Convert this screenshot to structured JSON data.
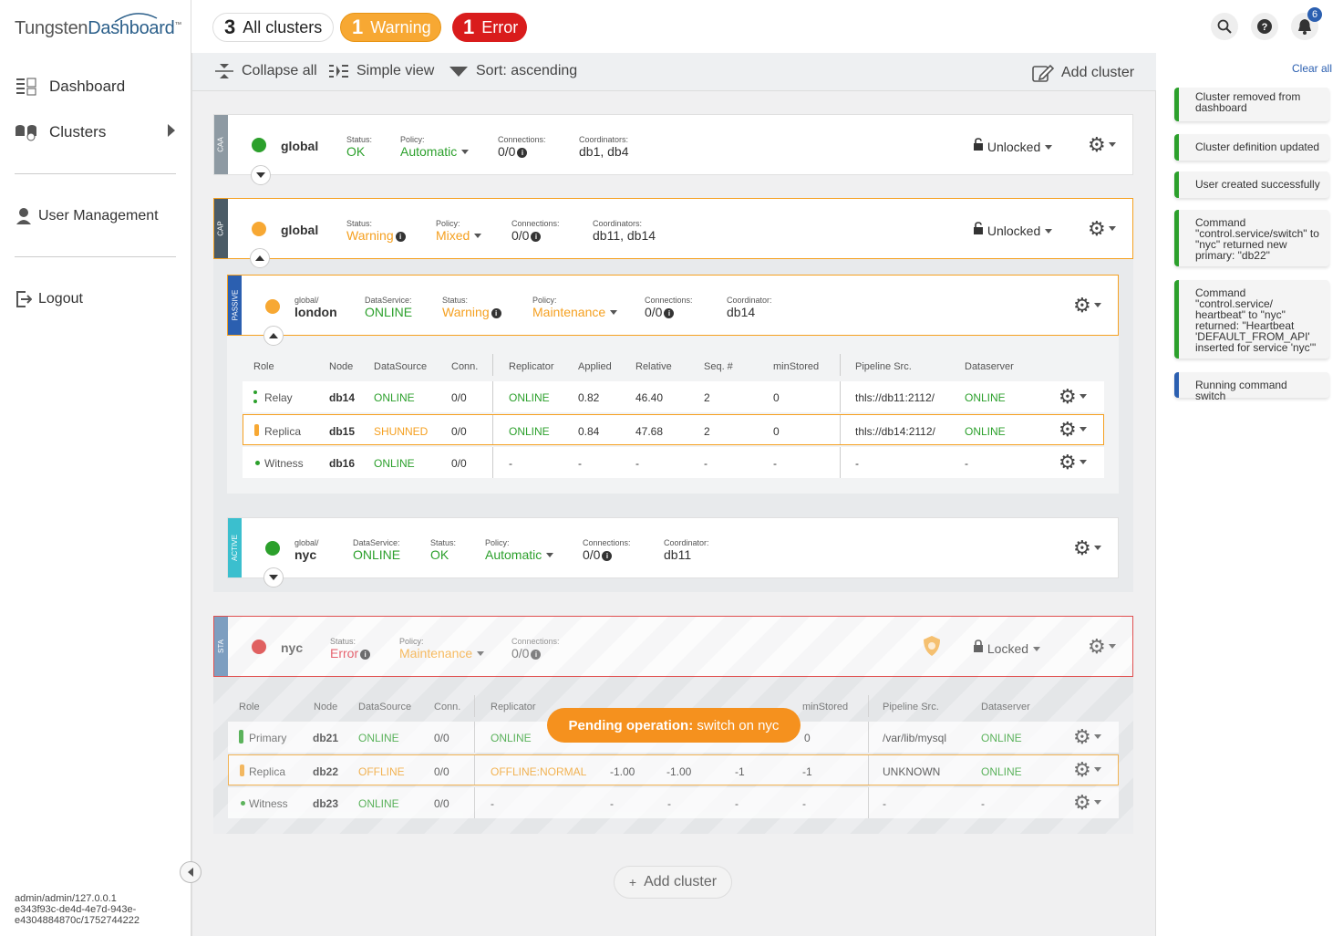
{
  "brand": {
    "part1": "Tungsten",
    "part2": "Dashboard",
    "tm": "™"
  },
  "nav": {
    "dashboard": "Dashboard",
    "clusters": "Clusters",
    "user_management": "User Management",
    "logout": "Logout"
  },
  "footer_info": {
    "line1": "admin/admin/127.0.0.1",
    "line2": "e343f93c-de4d-4e7d-943e-",
    "line3": "e4304884870c/1752744222"
  },
  "summary": {
    "all_count": "3",
    "all_label": "All clusters",
    "warning_count": "1",
    "warning_label": "Warning",
    "error_count": "1",
    "error_label": "Error"
  },
  "notifications_count": "6",
  "toolbar": {
    "collapse_all": "Collapse all",
    "simple_view": "Simple view",
    "sort": "Sort: ascending",
    "add_cluster": "Add cluster"
  },
  "labels": {
    "status": "Status:",
    "policy": "Policy:",
    "connections": "Connections:",
    "coordinators": "Coordinators:",
    "coordinator": "Coordinator:",
    "dataservice": "DataService:"
  },
  "caa": {
    "tag": "CAA",
    "name": "global",
    "status": "OK",
    "policy": "Automatic",
    "connections": "0/0",
    "coordinators": "db1, db4",
    "lock": "Unlocked"
  },
  "cap": {
    "tag": "CAP",
    "name": "global",
    "status": "Warning",
    "policy": "Mixed",
    "connections": "0/0",
    "coordinators": "db11, db14",
    "lock": "Unlocked"
  },
  "london": {
    "tag": "PASSIVE",
    "prefix": "global/",
    "name": "london",
    "dataservice": "ONLINE",
    "status": "Warning",
    "policy": "Maintenance",
    "connections": "0/0",
    "coordinator": "db14"
  },
  "table_headers": {
    "role": "Role",
    "node": "Node",
    "datasource": "DataSource",
    "conn": "Conn.",
    "replicator": "Replicator",
    "applied": "Applied",
    "relative": "Relative",
    "seq": "Seq. #",
    "minstored": "minStored",
    "pipeline": "Pipeline Src.",
    "dataserver": "Dataserver"
  },
  "london_rows": [
    {
      "role": "Relay",
      "node": "db14",
      "datasource": "ONLINE",
      "conn": "0/0",
      "replicator": "ONLINE",
      "applied": "0.82",
      "relative": "46.40",
      "seq": "2",
      "minstored": "0",
      "pipeline": "thls://db11:2112/",
      "dataserver": "ONLINE"
    },
    {
      "role": "Replica",
      "node": "db15",
      "datasource": "SHUNNED",
      "conn": "0/0",
      "replicator": "ONLINE",
      "applied": "0.84",
      "relative": "47.68",
      "seq": "2",
      "minstored": "0",
      "pipeline": "thls://db14:2112/",
      "dataserver": "ONLINE"
    },
    {
      "role": "Witness",
      "node": "db16",
      "datasource": "ONLINE",
      "conn": "0/0",
      "replicator": "-",
      "applied": "-",
      "relative": "-",
      "seq": "-",
      "minstored": "-",
      "pipeline": "-",
      "dataserver": "-"
    }
  ],
  "nyc_active": {
    "tag": "ACTIVE",
    "prefix": "global/",
    "name": "nyc",
    "dataservice": "ONLINE",
    "status": "OK",
    "policy": "Automatic",
    "connections": "0/0",
    "coordinator": "db11"
  },
  "sta": {
    "tag": "STA",
    "name": "nyc",
    "status": "Error",
    "policy": "Maintenance",
    "connections": "0/0",
    "lock": "Locked"
  },
  "sta_rows": [
    {
      "role": "Primary",
      "node": "db21",
      "datasource": "ONLINE",
      "conn": "0/0",
      "replicator": "ONLINE",
      "applied": "",
      "relative": "",
      "seq": "",
      "minstored": "0",
      "pipeline": "/var/lib/mysql",
      "dataserver": "ONLINE"
    },
    {
      "role": "Replica",
      "node": "db22",
      "datasource": "OFFLINE",
      "conn": "0/0",
      "replicator": "OFFLINE:NORMAL",
      "applied": "-1.00",
      "relative": "-1.00",
      "seq": "-1",
      "minstored": "-1",
      "pipeline": "UNKNOWN",
      "dataserver": "ONLINE"
    },
    {
      "role": "Witness",
      "node": "db23",
      "datasource": "ONLINE",
      "conn": "0/0",
      "replicator": "-",
      "applied": "-",
      "relative": "-",
      "seq": "-",
      "minstored": "-",
      "pipeline": "-",
      "dataserver": "-"
    }
  ],
  "pending": {
    "label": "Pending operation:",
    "text": " switch on nyc"
  },
  "add_cluster_bottom": "Add cluster",
  "clear_all": "Clear all",
  "notifications": [
    "Cluster removed from dashboard",
    "Cluster definition updated",
    "User created successfully",
    "Command \"control.service/switch\" to \"nyc\" returned new primary: \"db22\"",
    "Command \"control.service/ heartbeat\" to \"nyc\" returned: \"Heartbeat 'DEFAULT_FROM_API' inserted for service 'nyc'\"",
    "Running command switch"
  ],
  "colors": {
    "ok": "#2ca02c",
    "warning": "#f5a020",
    "error": "#d23",
    "info": "#2b5fb0"
  }
}
